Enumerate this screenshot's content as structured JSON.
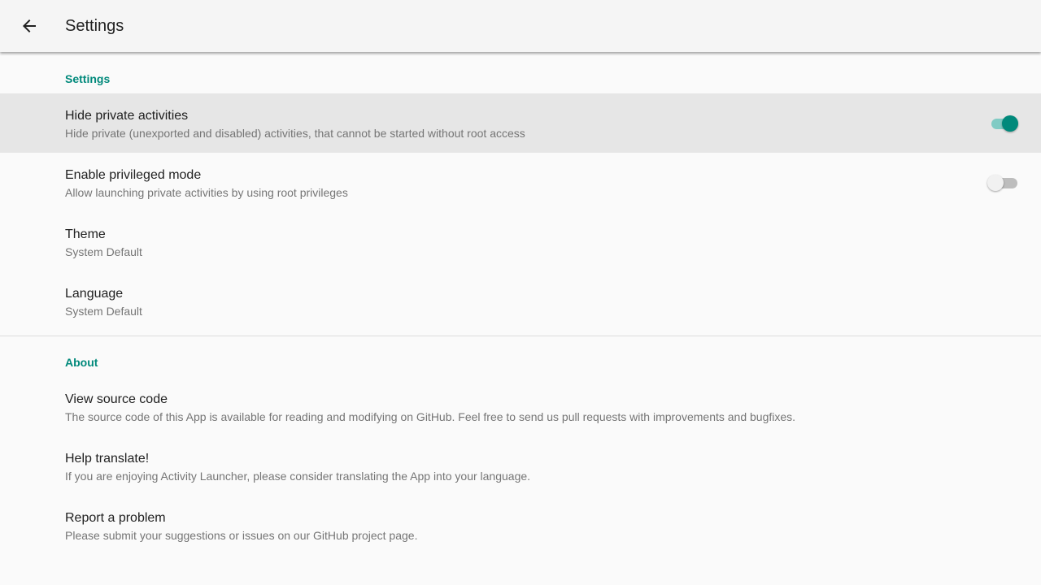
{
  "app_bar": {
    "title": "Settings",
    "back_icon": "arrow-left-icon"
  },
  "sections": {
    "settings": {
      "title": "Settings",
      "hide_private": {
        "title": "Hide private activities",
        "summary": "Hide private (unexported and disabled) activities, that cannot be started without root access",
        "enabled": true
      },
      "privileged": {
        "title": "Enable privileged mode",
        "summary": "Allow launching private activities by using root privileges",
        "enabled": false
      },
      "theme": {
        "title": "Theme",
        "summary": "System Default"
      },
      "language": {
        "title": "Language",
        "summary": "System Default"
      }
    },
    "about": {
      "title": "About",
      "source": {
        "title": "View source code",
        "summary": "The source code of this App is available for reading and modifying on GitHub. Feel free to send us pull requests with improvements and bugfixes."
      },
      "translate": {
        "title": "Help translate!",
        "summary": "If you are enjoying Activity Launcher, please consider translating the App into your language."
      },
      "report": {
        "title": "Report a problem",
        "summary": "Please submit your suggestions or issues on our GitHub project page."
      }
    }
  },
  "colors": {
    "accent": "#00897b",
    "accent_track": "#80cbc4",
    "app_bar": "#f5f5f5",
    "background": "#fafafa"
  }
}
